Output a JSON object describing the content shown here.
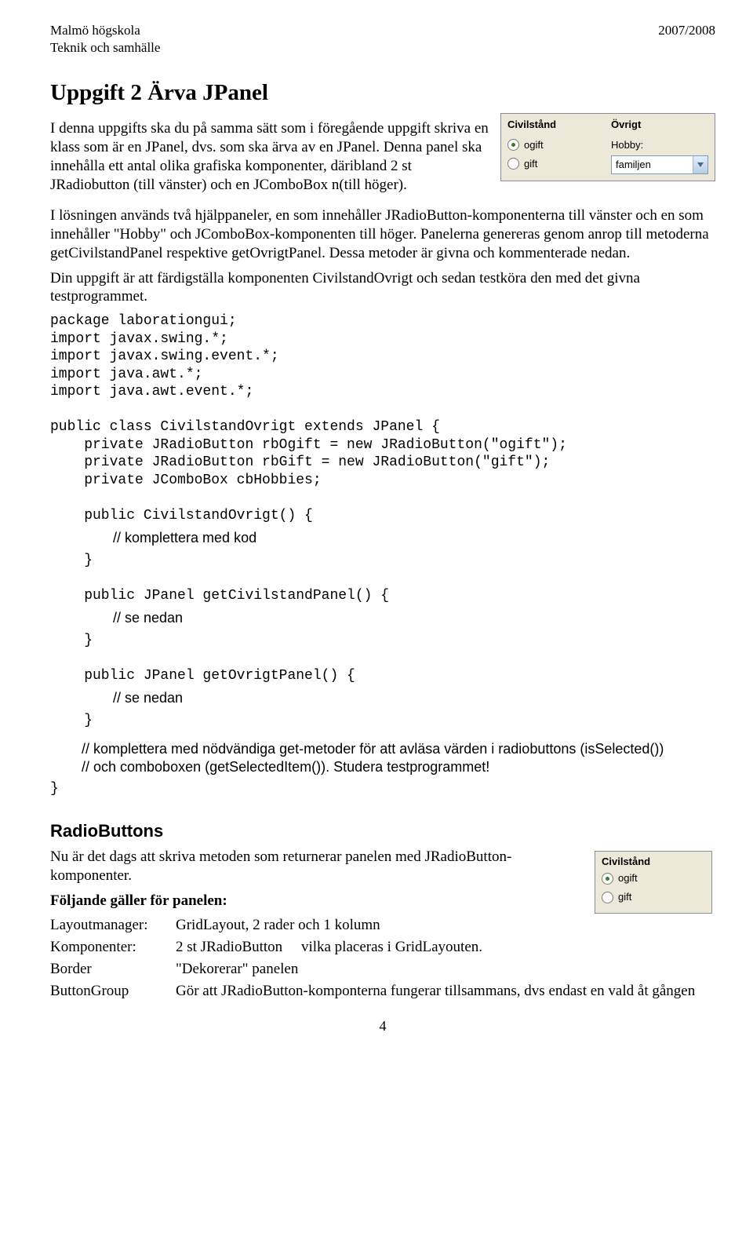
{
  "header": {
    "left1": "Malmö högskola",
    "left2": "Teknik och samhälle",
    "right": "2007/2008"
  },
  "title": "Uppgift 2 Ärva JPanel",
  "intro": {
    "p1": "I denna uppgifts ska du på samma sätt som i föregående uppgift skriva en klass som är en JPanel, dvs. som ska ärva av en JPanel. Denna panel ska innehålla ett antal olika grafiska komponenter, däribland 2 st JRadiobutton (till vänster) och en JComboBox n(till höger)."
  },
  "widget1": {
    "col1_label": "Civilstånd",
    "r1": "ogift",
    "r2": "gift",
    "col2_label": "Övrigt",
    "hobby_label": "Hobby:",
    "combo_val": "familjen"
  },
  "body": {
    "p2": "I lösningen används två hjälppaneler, en som innehåller JRadioButton-komponenterna till vänster och en som innehåller \"Hobby\" och JComboBox-komponenten till höger. Panelerna genereras genom anrop till metoderna getCivilstandPanel respektive getOvrigtPanel. Dessa metoder är givna och kommenterade nedan.",
    "p3": "Din uppgift är att färdigställa komponenten CivilstandOvrigt och sedan testköra den med det givna testprogrammet."
  },
  "code": {
    "l1": "package laborationgui;",
    "l2": "import javax.swing.*;",
    "l3": "import javax.swing.event.*;",
    "l4": "import java.awt.*;",
    "l5": "import java.awt.event.*;",
    "l6": "public class CivilstandOvrigt extends JPanel {",
    "l7": "    private JRadioButton rbOgift = new JRadioButton(\"ogift\");",
    "l8": "    private JRadioButton rbGift = new JRadioButton(\"gift\");",
    "l9": "    private JComboBox cbHobbies;",
    "l10": "    public CivilstandOvrigt() {",
    "cmt1": "// komplettera med kod",
    "l11": "    }",
    "l12": "    public JPanel getCivilstandPanel() {",
    "cmt2": "// se nedan",
    "l13": "    }",
    "l14": "    public JPanel getOvrigtPanel() {",
    "cmt3": "// se nedan",
    "l15": "    }",
    "cmt4": "// komplettera med nödvändiga get-metoder för att avläsa värden i radiobuttons (isSelected())",
    "cmt5": "// och comboboxen (getSelectedItem()). Studera testprogrammet!",
    "l16": "}"
  },
  "section2": {
    "heading": "RadioButtons",
    "p1": "Nu är det dags att skriva metoden som returnerar panelen med JRadioButton-komponenter.",
    "p2": "Följande gäller för panelen:"
  },
  "widget2": {
    "label": "Civilstånd",
    "r1": "ogift",
    "r2": "gift"
  },
  "props": {
    "k1": "Layoutmanager:",
    "v1": "GridLayout, 2 rader och 1 kolumn",
    "k2": "Komponenter:",
    "v2a": "2 st JRadioButton",
    "v2b": "vilka placeras i GridLayouten.",
    "k3": "Border",
    "v3": "\"Dekorerar\" panelen",
    "k4": "ButtonGroup",
    "v4": "Gör att JRadioButton-komponterna fungerar tillsammans, dvs endast en vald åt gången"
  },
  "pagenum": "4"
}
